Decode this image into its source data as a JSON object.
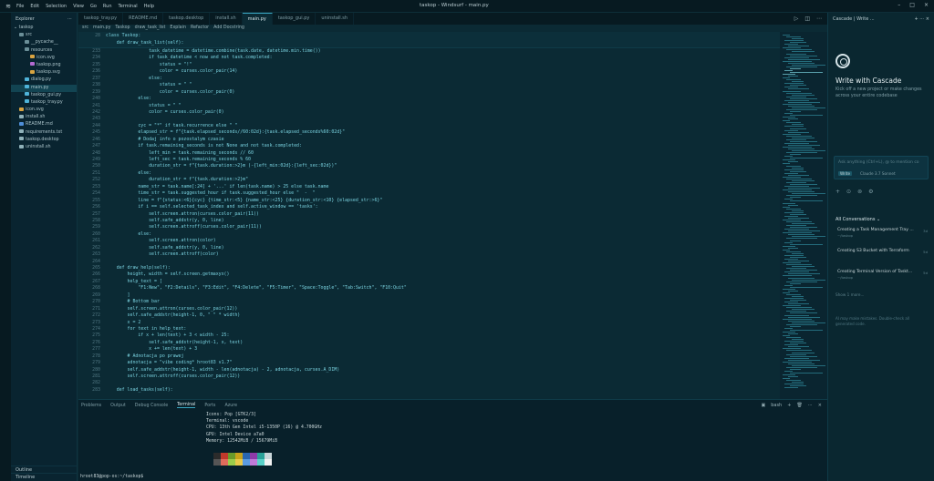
{
  "window": {
    "title": "taskop - Windsurf - main.py",
    "menu": [
      "File",
      "Edit",
      "Selection",
      "View",
      "Go",
      "Run",
      "Terminal",
      "Help"
    ]
  },
  "explorer": {
    "title": "Explorer",
    "root": "taskop",
    "items": [
      {
        "label": "src",
        "depth": 1,
        "color": "#6b8f98"
      },
      {
        "label": "__pycache__",
        "depth": 2,
        "color": "#6b8f98"
      },
      {
        "label": "resources",
        "depth": 2,
        "color": "#6b8f98"
      },
      {
        "label": "icon.svg",
        "depth": 3,
        "color": "#d9a441"
      },
      {
        "label": "taskop.png",
        "depth": 3,
        "color": "#b36ad0"
      },
      {
        "label": "taskop.svg",
        "depth": 3,
        "color": "#d9a441"
      },
      {
        "label": "dialog.py",
        "depth": 2,
        "color": "#4fb3d9"
      },
      {
        "label": "main.py",
        "depth": 2,
        "color": "#4fb3d9",
        "selected": true
      },
      {
        "label": "taskop_gui.py",
        "depth": 2,
        "color": "#4fb3d9"
      },
      {
        "label": "taskop_tray.py",
        "depth": 2,
        "color": "#4fb3d9"
      },
      {
        "label": "icon.svg",
        "depth": 1,
        "color": "#d9a441"
      },
      {
        "label": "install.sh",
        "depth": 1,
        "color": "#8fb1b9"
      },
      {
        "label": "README.md",
        "depth": 1,
        "color": "#4f8fd9"
      },
      {
        "label": "requirements.txt",
        "depth": 1,
        "color": "#8fb1b9"
      },
      {
        "label": "taskop.desktop",
        "depth": 1,
        "color": "#8fb1b9"
      },
      {
        "label": "uninstall.sh",
        "depth": 1,
        "color": "#8fb1b9"
      }
    ],
    "outline": "Outline",
    "timeline": "Timeline"
  },
  "tabs": [
    {
      "label": "taskop_tray.py",
      "active": false
    },
    {
      "label": "README.md",
      "active": false
    },
    {
      "label": "taskop.desktop",
      "active": false
    },
    {
      "label": "install.sh",
      "active": false
    },
    {
      "label": "main.py",
      "active": true
    },
    {
      "label": "taskop_gui.py",
      "active": false
    },
    {
      "label": "uninstall.sh",
      "active": false
    }
  ],
  "breadcrumb": [
    "src",
    "main.py",
    "Taskop",
    "draw_task_list",
    "Explain",
    "Refactor",
    "Add Docstring"
  ],
  "sticky": [
    {
      "ln": "28",
      "text": "class Taskop:"
    },
    {
      "ln": "",
      "text": "    def draw_task_list(self):"
    }
  ],
  "code": [
    {
      "ln": "233",
      "text": "                task_datetime = datetime.combine(task.date, datetime.min.time())"
    },
    {
      "ln": "234",
      "text": "                if task_datetime < now and not task.completed:"
    },
    {
      "ln": "235",
      "text": "                    status = \"!\""
    },
    {
      "ln": "236",
      "text": "                    color = curses.color_pair(14)"
    },
    {
      "ln": "237",
      "text": "                else:"
    },
    {
      "ln": "238",
      "text": "                    status = \" \""
    },
    {
      "ln": "239",
      "text": "                    color = curses.color_pair(0)"
    },
    {
      "ln": "240",
      "text": "            else:"
    },
    {
      "ln": "241",
      "text": "                status = \" \""
    },
    {
      "ln": "242",
      "text": "                color = curses.color_pair(0)"
    },
    {
      "ln": "243",
      "text": ""
    },
    {
      "ln": "244",
      "text": "            cyc = \"*\" if task.recurrence else \" \""
    },
    {
      "ln": "245",
      "text": "            elapsed_str = f\"{task.elapsed_seconds//60:02d}:{task.elapsed_seconds%60:02d}\""
    },
    {
      "ln": "246",
      "text": "            # Dodaj info o pozostalym czasie"
    },
    {
      "ln": "247",
      "text": "            if task.remaining_seconds is not None and not task.completed:"
    },
    {
      "ln": "248",
      "text": "                left_min = task.remaining_seconds // 60"
    },
    {
      "ln": "249",
      "text": "                left_sec = task.remaining_seconds % 60"
    },
    {
      "ln": "250",
      "text": "                duration_str = f\"{task.duration:>2}m (-{left_min:02d}:{left_sec:02d})\""
    },
    {
      "ln": "251",
      "text": "            else:"
    },
    {
      "ln": "252",
      "text": "                duration_str = f\"{task.duration:>2}m\""
    },
    {
      "ln": "253",
      "text": "            name_str = task.name[:24] + '...' if len(task.name) > 25 else task.name"
    },
    {
      "ln": "254",
      "text": "            time_str = task.suggested_hour if task.suggested_hour else \"  -  \""
    },
    {
      "ln": "255",
      "text": "            line = f\"{status:<6}{cyc} {time_str:<5} {name_str:<25} {duration_str:<10} {elapsed_str:>6}\""
    },
    {
      "ln": "256",
      "text": "            if i == self.selected_task_index and self.active_window == 'tasks':"
    },
    {
      "ln": "257",
      "text": "                self.screen.attron(curses.color_pair(11))"
    },
    {
      "ln": "258",
      "text": "                self.safe_addstr(y, 0, line)"
    },
    {
      "ln": "259",
      "text": "                self.screen.attroff(curses.color_pair(11))"
    },
    {
      "ln": "260",
      "text": "            else:"
    },
    {
      "ln": "261",
      "text": "                self.screen.attron(color)"
    },
    {
      "ln": "262",
      "text": "                self.safe_addstr(y, 0, line)"
    },
    {
      "ln": "263",
      "text": "                self.screen.attroff(color)"
    },
    {
      "ln": "264",
      "text": ""
    },
    {
      "ln": "265",
      "text": "    def draw_help(self):"
    },
    {
      "ln": "266",
      "text": "        height, width = self.screen.getmaxyx()"
    },
    {
      "ln": "267",
      "text": "        help_text = ["
    },
    {
      "ln": "268",
      "text": "            \"F1:New\", \"F2:Details\", \"F3:Edit\", \"F4:Delete\", \"F5:Timer\", \"Space:Toggle\", \"Tab:Switch\", \"F10:Quit\""
    },
    {
      "ln": "269",
      "text": "        ]"
    },
    {
      "ln": "270",
      "text": "        # Bottom bar"
    },
    {
      "ln": "271",
      "text": "        self.screen.attron(curses.color_pair(12))"
    },
    {
      "ln": "272",
      "text": "        self.safe_addstr(height-1, 0, \" \" * width)"
    },
    {
      "ln": "273",
      "text": "        x = 2"
    },
    {
      "ln": "274",
      "text": "        for text in help_text:"
    },
    {
      "ln": "275",
      "text": "            if x + len(text) + 3 < width - 25:"
    },
    {
      "ln": "276",
      "text": "                self.safe_addstr(height-1, x, text)"
    },
    {
      "ln": "277",
      "text": "                x += len(text) + 3"
    },
    {
      "ln": "278",
      "text": "        # Adnotacja po prawej"
    },
    {
      "ln": "279",
      "text": "        adnotacja = \"vibe coding* hroot83 v1.7\""
    },
    {
      "ln": "280",
      "text": "        self.safe_addstr(height-1, width - len(adnotacja) - 2, adnotacja, curses.A_DIM)"
    },
    {
      "ln": "281",
      "text": "        self.screen.attroff(curses.color_pair(12))"
    },
    {
      "ln": "282",
      "text": ""
    },
    {
      "ln": "283",
      "text": "    def load_tasks(self):"
    }
  ],
  "panel": {
    "tabs": [
      {
        "label": "Problems",
        "active": false
      },
      {
        "label": "Output",
        "active": false
      },
      {
        "label": "Debug Console",
        "active": false
      },
      {
        "label": "Terminal",
        "active": true
      },
      {
        "label": "Ports",
        "active": false
      },
      {
        "label": "Azure",
        "active": false
      }
    ],
    "shell": "bash",
    "terminal_lines": [
      "Icons: Pop [GTK2/3]",
      "Terminal: vscode",
      "CPU: 13th Gen Intel i5-1350P (16) @ 4.700GHz",
      "GPU: Intel Device a7a0",
      "Memory: 12542MiB / 15679MiB"
    ],
    "swatch_top": [
      "#2b2b2b",
      "#c0392b",
      "#6a9a2a",
      "#c8a21a",
      "#2a66b0",
      "#8e3aa8",
      "#2aa198",
      "#c9d6d9"
    ],
    "swatch_bottom": [
      "#555555",
      "#e06c5c",
      "#9ccc4a",
      "#e8c84a",
      "#5a9ae0",
      "#c07ad8",
      "#5ad1c8",
      "#f2f2f2"
    ],
    "prompt": "hroot83@pop-os:~/taskop$"
  },
  "cascade": {
    "header": "Cascade | Write ...",
    "title": "Write with Cascade",
    "description": "Kick off a new project or make changes across your entire codebase",
    "input_placeholder": "Ask anything (Ctrl+L), @ to mention co",
    "mode": "Write",
    "model": "Claude 3.7 Sonnet",
    "conversations_label": "All Conversations",
    "conversations": [
      {
        "title": "Creating a Task Management Tray ...",
        "sub": "~/taskop",
        "time": "3d"
      },
      {
        "title": "Creating S3 Bucket with Terraform",
        "sub": "",
        "time": "5d"
      },
      {
        "title": "Creating Terminal Version of Taskt...",
        "sub": "~/taskop",
        "time": "5d"
      }
    ],
    "show_all": "Show 1 more...",
    "note": "AI may make mistakes. Double-check all generated code."
  }
}
